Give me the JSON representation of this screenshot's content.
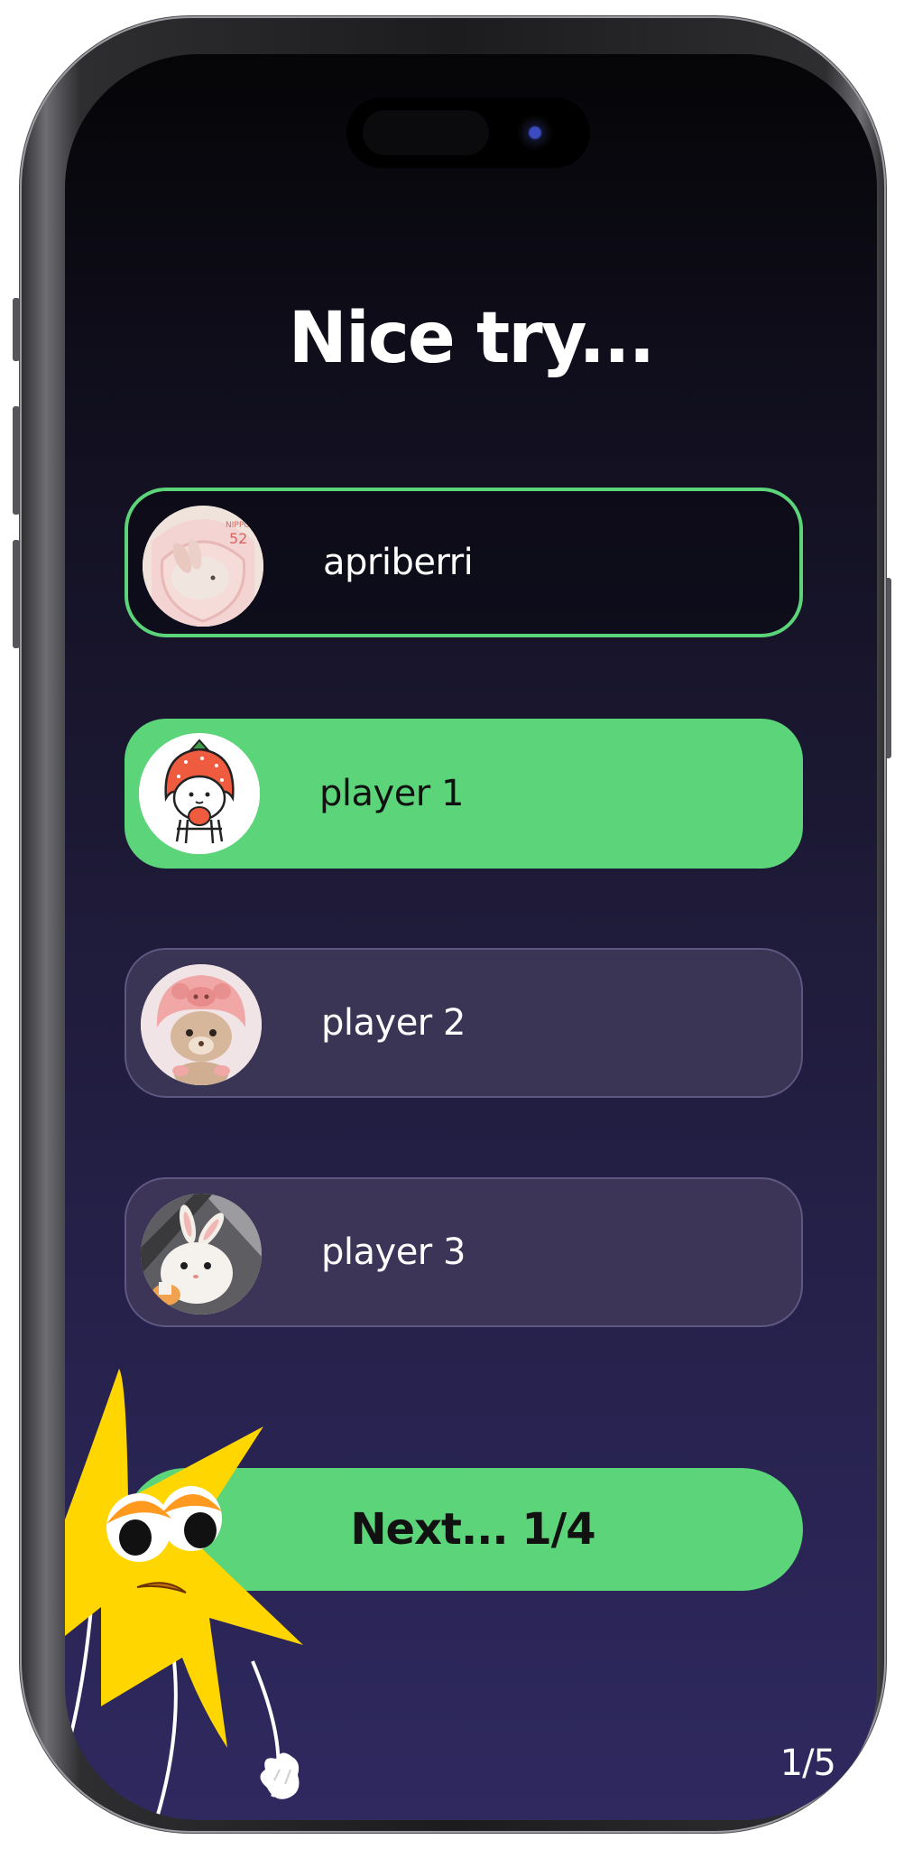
{
  "screen": {
    "title": "Nice try...",
    "players": [
      {
        "name": "apriberri",
        "avatar_icon": "bunny-stamp-avatar",
        "state": "you"
      },
      {
        "name": "player 1",
        "avatar_icon": "strawberry-hood-avatar",
        "state": "highlighted"
      },
      {
        "name": "player 2",
        "avatar_icon": "plush-bear-avatar",
        "state": "default"
      },
      {
        "name": "player 3",
        "avatar_icon": "bunny-plush-avatar",
        "state": "default"
      }
    ],
    "next_button_label": "Next... 1/4",
    "page_indicator": "1/5"
  },
  "colors": {
    "accent": "#5cd57a",
    "background_top": "#050507",
    "background_bottom": "#2f2960",
    "card_bg": "#3a3455",
    "mascot_yellow": "#ffd600"
  }
}
